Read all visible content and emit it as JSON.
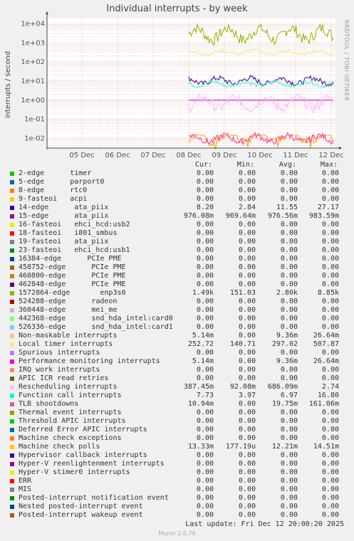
{
  "chart_data": {
    "type": "line",
    "title": "Individual interrupts - by week",
    "ylabel": "interrupts / second",
    "yscale": "log",
    "ylim": [
      0.003,
      20000
    ],
    "yticks": [
      "1e+04",
      "1e+03",
      "1e+02",
      "1e+01",
      "1e+00",
      "1e-01",
      "1e-02"
    ],
    "xticks": [
      "05 Dec",
      "06 Dec",
      "07 Dec",
      "08 Dec",
      "09 Dec",
      "10 Dec",
      "11 Dec",
      "12 Dec"
    ],
    "grid": true,
    "data_start": "08 Dec",
    "series_levels": [
      {
        "name": "1572864-edge",
        "color": "#8fb300",
        "level": 2800,
        "low": 150,
        "high": 8850
      },
      {
        "name": "Local timer interrupts",
        "color": "#ffe680",
        "level": 300,
        "low": 140,
        "high": 508
      },
      {
        "name": "Hypervisor callback interrupts",
        "color": "#330099",
        "level": 10,
        "low": 3,
        "high": 20
      },
      {
        "name": "Function call interrupts",
        "color": "#33ffcc",
        "level": 6.97,
        "low": 3.97,
        "high": 16.8
      },
      {
        "name": "15-edge",
        "color": "#cc00cc",
        "level": 0.977,
        "low": 0.97,
        "high": 0.984
      },
      {
        "name": "Rescheduling interrupts",
        "color": "#ffb3ff",
        "level": 0.686,
        "low": 0.092,
        "high": 2.74
      },
      {
        "name": "Machine check polls",
        "color": "#ff9900",
        "level": 0.0122,
        "low": 0.0002,
        "high": 0.0145
      },
      {
        "name": "Performance monitoring interrupts",
        "color": "#ff3399",
        "level": 0.0094,
        "low": 0.003,
        "high": 0.0266
      }
    ]
  },
  "legend_header": {
    "cur": "Cur:",
    "min": "Min:",
    "avg": "Avg:",
    "max": "Max:"
  },
  "legend": [
    {
      "name": "2-edge      timer",
      "color": "#00cc00",
      "cur": "0.00",
      "min": "0.00",
      "avg": "0.00",
      "max": "0.00"
    },
    {
      "name": "5-edge      parport0",
      "color": "#0066b3",
      "cur": "0.00",
      "min": "0.00",
      "avg": "0.00",
      "max": "0.00"
    },
    {
      "name": "8-edge      rtc0",
      "color": "#ff8000",
      "cur": "0.00",
      "min": "0.00",
      "avg": "0.00",
      "max": "0.00"
    },
    {
      "name": "9-fasteoi   acpi",
      "color": "#ffcc00",
      "cur": "0.00",
      "min": "0.00",
      "avg": "0.00",
      "max": "0.00"
    },
    {
      "name": "14-edge      ata_piix",
      "color": "#330099",
      "cur": "8.20",
      "min": "2.84",
      "avg": "11.55",
      "max": "27.17"
    },
    {
      "name": "15-edge      ata_piix",
      "color": "#990099",
      "cur": "976.08m",
      "min": "969.64m",
      "avg": "976.56m",
      "max": "983.59m"
    },
    {
      "name": "16-fasteoi   ehci_hcd:usb2",
      "color": "#ccff00",
      "cur": "0.00",
      "min": "0.00",
      "avg": "0.00",
      "max": "0.00"
    },
    {
      "name": "18-fasteoi   i801_smbus",
      "color": "#ff0000",
      "cur": "0.00",
      "min": "0.00",
      "avg": "0.00",
      "max": "0.00"
    },
    {
      "name": "19-fasteoi   ata_piix",
      "color": "#808080",
      "cur": "0.00",
      "min": "0.00",
      "avg": "0.00",
      "max": "0.00"
    },
    {
      "name": "23-fasteoi   ehci_hcd:usb1",
      "color": "#008f00",
      "cur": "0.00",
      "min": "0.00",
      "avg": "0.00",
      "max": "0.00"
    },
    {
      "name": "16384-edge      PCIe PME",
      "color": "#00487d",
      "cur": "0.00",
      "min": "0.00",
      "avg": "0.00",
      "max": "0.00"
    },
    {
      "name": "458752-edge      PCIe PME",
      "color": "#b35a00",
      "cur": "0.00",
      "min": "0.00",
      "avg": "0.00",
      "max": "0.00"
    },
    {
      "name": "460800-edge      PCIe PME",
      "color": "#b38f00",
      "cur": "0.00",
      "min": "0.00",
      "avg": "0.00",
      "max": "0.00"
    },
    {
      "name": "462848-edge      PCIe PME",
      "color": "#6b006b",
      "cur": "0.00",
      "min": "0.00",
      "avg": "0.00",
      "max": "0.00"
    },
    {
      "name": "1572864-edge       enp3s0",
      "color": "#8fb300",
      "cur": "1.49k",
      "min": "151.03",
      "avg": "2.80k",
      "max": "8.85k"
    },
    {
      "name": "524288-edge      radeon",
      "color": "#b30000",
      "cur": "0.00",
      "min": "0.00",
      "avg": "0.00",
      "max": "0.00"
    },
    {
      "name": "360448-edge      mei_me",
      "color": "#bebebe",
      "cur": "0.00",
      "min": "0.00",
      "avg": "0.00",
      "max": "0.00"
    },
    {
      "name": "442368-edge      snd_hda_intel:card0",
      "color": "#80ff80",
      "cur": "0.00",
      "min": "0.00",
      "avg": "0.00",
      "max": "0.00"
    },
    {
      "name": "526336-edge      snd_hda_intel:card1",
      "color": "#80c9ff",
      "cur": "0.00",
      "min": "0.00",
      "avg": "0.00",
      "max": "0.00"
    },
    {
      "name": "Non-maskable interrupts",
      "color": "#ffc080",
      "cur": "5.14m",
      "min": "0.00",
      "avg": "9.36m",
      "max": "26.64m"
    },
    {
      "name": "Local timer interrupts",
      "color": "#ffe680",
      "cur": "252.72",
      "min": "140.71",
      "avg": "297.02",
      "max": "507.87"
    },
    {
      "name": "Spurious interrupts",
      "color": "#aa80ff",
      "cur": "0.00",
      "min": "0.00",
      "avg": "0.00",
      "max": "0.00"
    },
    {
      "name": "Performance monitoring interrupts",
      "color": "#ee00cc",
      "cur": "5.14m",
      "min": "0.00",
      "avg": "9.36m",
      "max": "26.64m"
    },
    {
      "name": "IRQ work interrupts",
      "color": "#ff8080",
      "cur": "0.00",
      "min": "0.00",
      "avg": "0.00",
      "max": "0.00"
    },
    {
      "name": "APIC ICR read retries",
      "color": "#666600",
      "cur": "0.00",
      "min": "0.00",
      "avg": "0.00",
      "max": "0.00"
    },
    {
      "name": "Rescheduling interrupts",
      "color": "#ffbfff",
      "cur": "387.45m",
      "min": "92.08m",
      "avg": "686.09m",
      "max": "2.74"
    },
    {
      "name": "Function call interrupts",
      "color": "#00ffcc",
      "cur": "7.73",
      "min": "3.97",
      "avg": "6.97",
      "max": "16.80"
    },
    {
      "name": "TLB shootdowns",
      "color": "#cc6699",
      "cur": "10.94m",
      "min": "0.00",
      "avg": "19.75m",
      "max": "161.06m"
    },
    {
      "name": "Thermal event interrupts",
      "color": "#999900",
      "cur": "0.00",
      "min": "0.00",
      "avg": "0.00",
      "max": "0.00"
    },
    {
      "name": "Threshold APIC interrupts",
      "color": "#00cc00",
      "cur": "0.00",
      "min": "0.00",
      "avg": "0.00",
      "max": "0.00"
    },
    {
      "name": "Deferred Error APIC interrupts",
      "color": "#0066b3",
      "cur": "0.00",
      "min": "0.00",
      "avg": "0.00",
      "max": "0.00"
    },
    {
      "name": "Machine check exceptions",
      "color": "#ff8000",
      "cur": "0.00",
      "min": "0.00",
      "avg": "0.00",
      "max": "0.00"
    },
    {
      "name": "Machine check polls",
      "color": "#ffcc00",
      "cur": "13.33m",
      "min": "177.19u",
      "avg": "12.21m",
      "max": "14.51m"
    },
    {
      "name": "Hypervisor callback interrupts",
      "color": "#330099",
      "cur": "0.00",
      "min": "0.00",
      "avg": "0.00",
      "max": "0.00"
    },
    {
      "name": "Hyper-V reenlightenment interrupts",
      "color": "#990099",
      "cur": "0.00",
      "min": "0.00",
      "avg": "0.00",
      "max": "0.00"
    },
    {
      "name": "Hyper-V stimer0 interrupts",
      "color": "#ccff00",
      "cur": "0.00",
      "min": "0.00",
      "avg": "0.00",
      "max": "0.00"
    },
    {
      "name": "ERR",
      "color": "#ff0000",
      "cur": "0.00",
      "min": "0.00",
      "avg": "0.00",
      "max": "0.00"
    },
    {
      "name": "MIS",
      "color": "#808080",
      "cur": "0.00",
      "min": "0.00",
      "avg": "0.00",
      "max": "0.00"
    },
    {
      "name": "Posted-interrupt notification event",
      "color": "#008f00",
      "cur": "0.00",
      "min": "0.00",
      "avg": "0.00",
      "max": "0.00"
    },
    {
      "name": "Nested posted-interrupt event",
      "color": "#00487d",
      "cur": "0.00",
      "min": "0.00",
      "avg": "0.00",
      "max": "0.00"
    },
    {
      "name": "Posted-interrupt wakeup event",
      "color": "#b35a00",
      "cur": "0.00",
      "min": "0.00",
      "avg": "0.00",
      "max": "0.00"
    }
  ],
  "side_label": "RRDTOOL / TOBI OETIKER",
  "last_update": "Last update: Fri Dec 12 20:00:20 2025",
  "version": "Munin 2.0.76"
}
